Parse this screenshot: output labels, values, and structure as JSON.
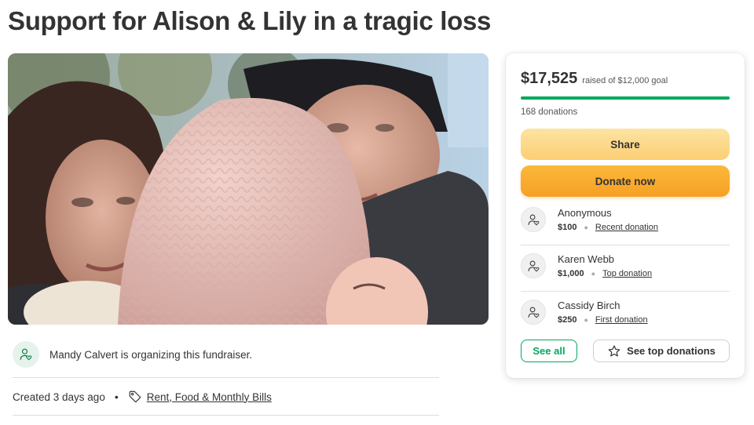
{
  "title": "Support for Alison & Lily in a tragic loss",
  "organizer": {
    "text": "Mandy Calvert is organizing this fundraiser.",
    "icon": "user-heart-icon"
  },
  "meta": {
    "created": "Created 3 days ago",
    "separator": "•",
    "category": "Rent, Food & Monthly Bills",
    "category_icon": "tag-icon"
  },
  "card": {
    "raised": "$17,525",
    "goal_text": "raised of $12,000 goal",
    "progress_percent": 100,
    "donation_count": "168 donations",
    "share_label": "Share",
    "donate_label": "Donate now",
    "see_all_label": "See all",
    "see_top_label": "See top donations",
    "donations": [
      {
        "name": "Anonymous",
        "amount": "$100",
        "type": "Recent donation"
      },
      {
        "name": "Karen Webb",
        "amount": "$1,000",
        "type": "Top donation"
      },
      {
        "name": "Cassidy Birch",
        "amount": "$250",
        "type": "First donation"
      }
    ]
  },
  "colors": {
    "brand_green": "#02a95c",
    "donate_orange": "#f6a024",
    "share_yellow": "#fbcf74",
    "text": "#333333"
  }
}
